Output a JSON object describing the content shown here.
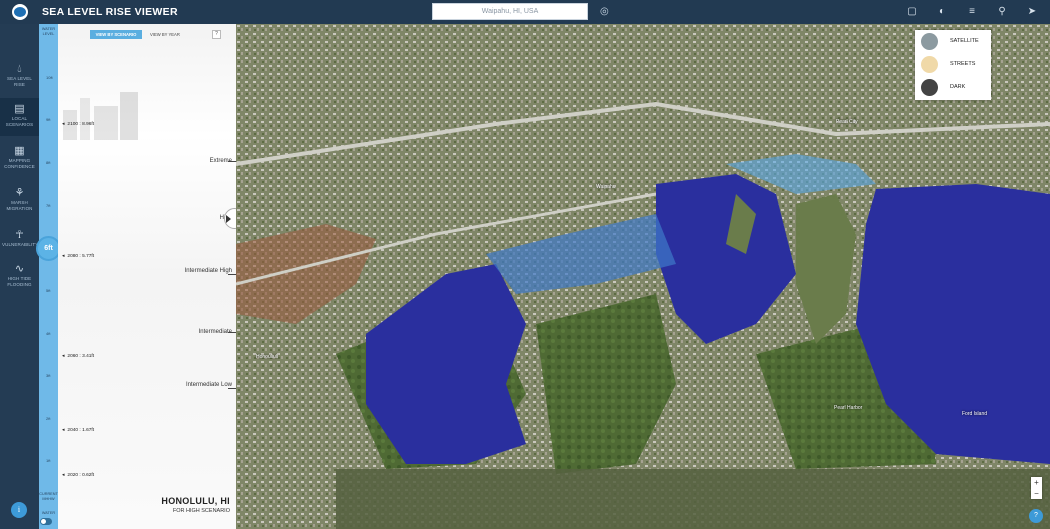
{
  "header": {
    "title": "SEA LEVEL RISE VIEWER",
    "search_value": "Waipahu, HI, USA"
  },
  "nav": {
    "items": [
      {
        "label": "SEA LEVEL RISE",
        "icon": "water-drop-icon"
      },
      {
        "label": "LOCAL SCENARIOS",
        "icon": "document-icon"
      },
      {
        "label": "MAPPING CONFIDENCE",
        "icon": "map-icon"
      },
      {
        "label": "MARSH MIGRATION",
        "icon": "plant-icon"
      },
      {
        "label": "VULNERABILITY",
        "icon": "people-icon"
      },
      {
        "label": "HIGH TIDE FLOODING",
        "icon": "wave-icon"
      }
    ],
    "info_label": "i"
  },
  "water_level": {
    "label": "WATER LEVEL",
    "current_value": "6ft",
    "ticks": [
      "10ft",
      "9ft",
      "8ft",
      "7ft",
      "5ft",
      "4ft",
      "3ft",
      "2ft",
      "1ft"
    ],
    "bottom_label": "CURRENT MHHW",
    "toggle_label": "WATER"
  },
  "panel": {
    "view_by_scenario": "VIEW BY SCENARIO",
    "view_by_year": "VIEW BY YEAR",
    "help": "?",
    "years": [
      "2100 : 8.96ft",
      "2080 : 5.77ft",
      "2060 : 3.41ft",
      "2040 : 1.67ft",
      "2020 : 0.62ft"
    ],
    "scenarios": [
      "Extreme",
      "High",
      "Intermediate High",
      "Intermediate",
      "Intermediate Low"
    ],
    "city": "HONOLULU, HI",
    "subtitle": "FOR HIGH SCENARIO"
  },
  "map": {
    "labels": [
      "Pearl Harbor",
      "Waipahu",
      "Ford Island",
      "Pearl City",
      "Honouliuli"
    ],
    "basemaps": [
      "SATELLITE",
      "STREETS",
      "DARK"
    ],
    "zoom_in": "+",
    "zoom_out": "−",
    "help": "?"
  },
  "colors": {
    "header": "#223a52",
    "slider": "#6fb9e8",
    "flood": "#2a2f9e"
  }
}
